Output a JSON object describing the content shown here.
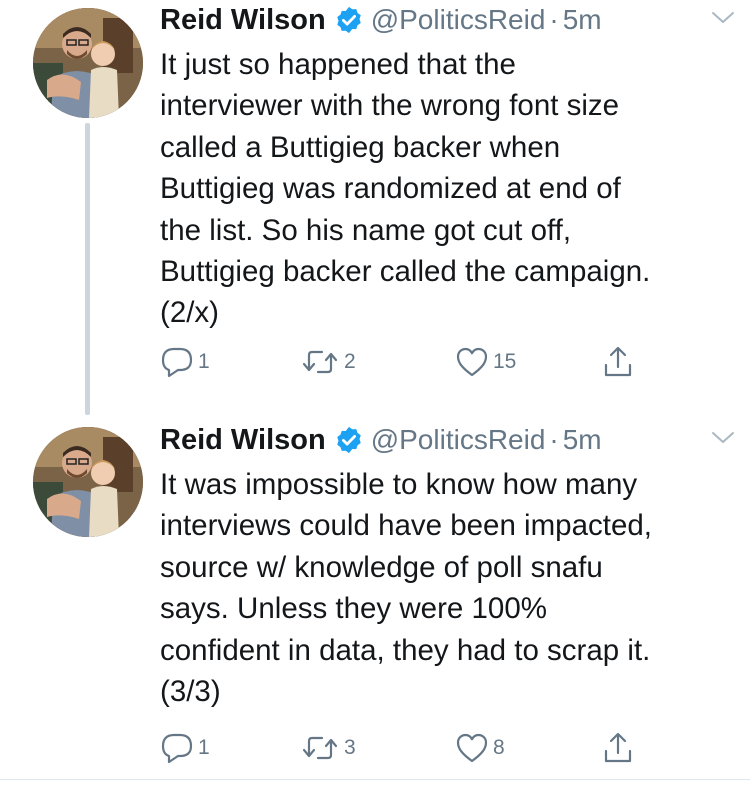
{
  "tweets": [
    {
      "author": {
        "name": "Reid Wilson",
        "handle": "@PoliticsReid",
        "verified": true,
        "avatar": "profile-photo"
      },
      "separator": "·",
      "time": "5m",
      "text_lines": [
        "It just so happened that the",
        "interviewer with the wrong font size",
        "called a Buttigieg backer when",
        "Buttigieg was randomized at end of",
        "the list. So his name got cut off,",
        "Buttigieg backer called the campaign.",
        "(2/x)"
      ],
      "counts": {
        "replies": "1",
        "retweets": "2",
        "likes": "15"
      }
    },
    {
      "author": {
        "name": "Reid Wilson",
        "handle": "@PoliticsReid",
        "verified": true,
        "avatar": "profile-photo"
      },
      "separator": "·",
      "time": "5m",
      "text_lines": [
        "It was impossible to know how many",
        "interviews could have been impacted,",
        "source w/ knowledge of poll snafu",
        "says. Unless they were 100%",
        "confident in data, they had to scrap it.",
        "(3/3)"
      ],
      "counts": {
        "replies": "1",
        "retweets": "3",
        "likes": "8"
      }
    }
  ],
  "icons": {
    "verified": "verified-badge-icon",
    "caret": "chevron-down-icon",
    "reply": "reply-icon",
    "retweet": "retweet-icon",
    "like": "heart-icon",
    "share": "share-icon"
  },
  "colors": {
    "text": "#14171a",
    "secondary": "#657786",
    "verified": "#1da1f2",
    "thread_line": "#ccd6dd",
    "divider": "#e1e8ed"
  }
}
